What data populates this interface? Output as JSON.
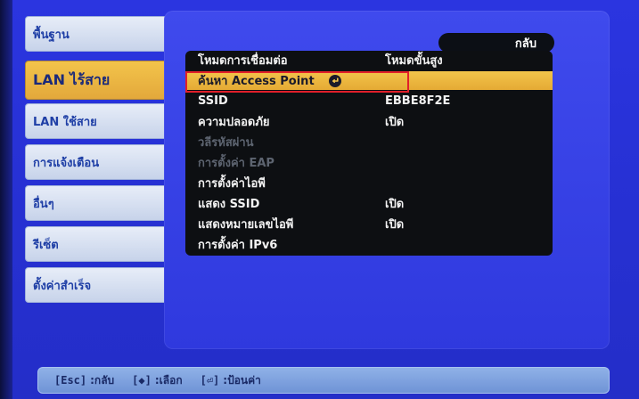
{
  "menu": {
    "items": [
      {
        "label": "พื้นฐาน",
        "active": false
      },
      {
        "label": "LAN ไร้สาย",
        "active": true
      },
      {
        "label": "LAN ใช้สาย",
        "active": false
      },
      {
        "label": "การแจ้งเตือน",
        "active": false
      },
      {
        "label": "อื่นๆ",
        "active": false
      },
      {
        "label": "รีเซ็ต",
        "active": false
      },
      {
        "label": "ตั้งค่าสำเร็จ",
        "active": false
      }
    ]
  },
  "panel": {
    "back_label": "กลับ",
    "rows": [
      {
        "label": "โหมดการเชื่อมต่อ",
        "value": "โหมดขั้นสูง",
        "state": "normal"
      },
      {
        "label": "ค้นหา Access Point",
        "value": "",
        "state": "selected",
        "has_enter_icon": true
      },
      {
        "label": "SSID",
        "value": "EBBE8F2E",
        "state": "normal"
      },
      {
        "label": "ความปลอดภัย",
        "value": "เปิด",
        "state": "normal"
      },
      {
        "label": "วลีรหัสผ่าน",
        "value": "",
        "state": "disabled"
      },
      {
        "label": "การตั้งค่า EAP",
        "value": "",
        "state": "disabled"
      },
      {
        "label": "การตั้งค่าไอพี",
        "value": "",
        "state": "normal"
      },
      {
        "label": "แสดง SSID",
        "value": "เปิด",
        "state": "normal"
      },
      {
        "label": "แสดงหมายเลขไอพี",
        "value": "เปิด",
        "state": "normal"
      },
      {
        "label": "การตั้งค่า IPv6",
        "value": "",
        "state": "normal"
      }
    ]
  },
  "help_bar": {
    "items": [
      {
        "key": "[Esc]",
        "text": ":กลับ"
      },
      {
        "key": "[◆]",
        "text": ":เลือก"
      },
      {
        "key": "[⏎]",
        "text": ":ป้อนค่า"
      }
    ]
  },
  "colors": {
    "screen_blue": "#2a34d8",
    "panel_blue": "#3f4aed",
    "menu_tab": "#dbe3f4",
    "menu_active": "#f3c44b",
    "list_bg": "#0d0f12",
    "row_selected": "#f3c44b",
    "highlight_red": "#e11f2a",
    "help_bar": "#8fb1e7"
  }
}
